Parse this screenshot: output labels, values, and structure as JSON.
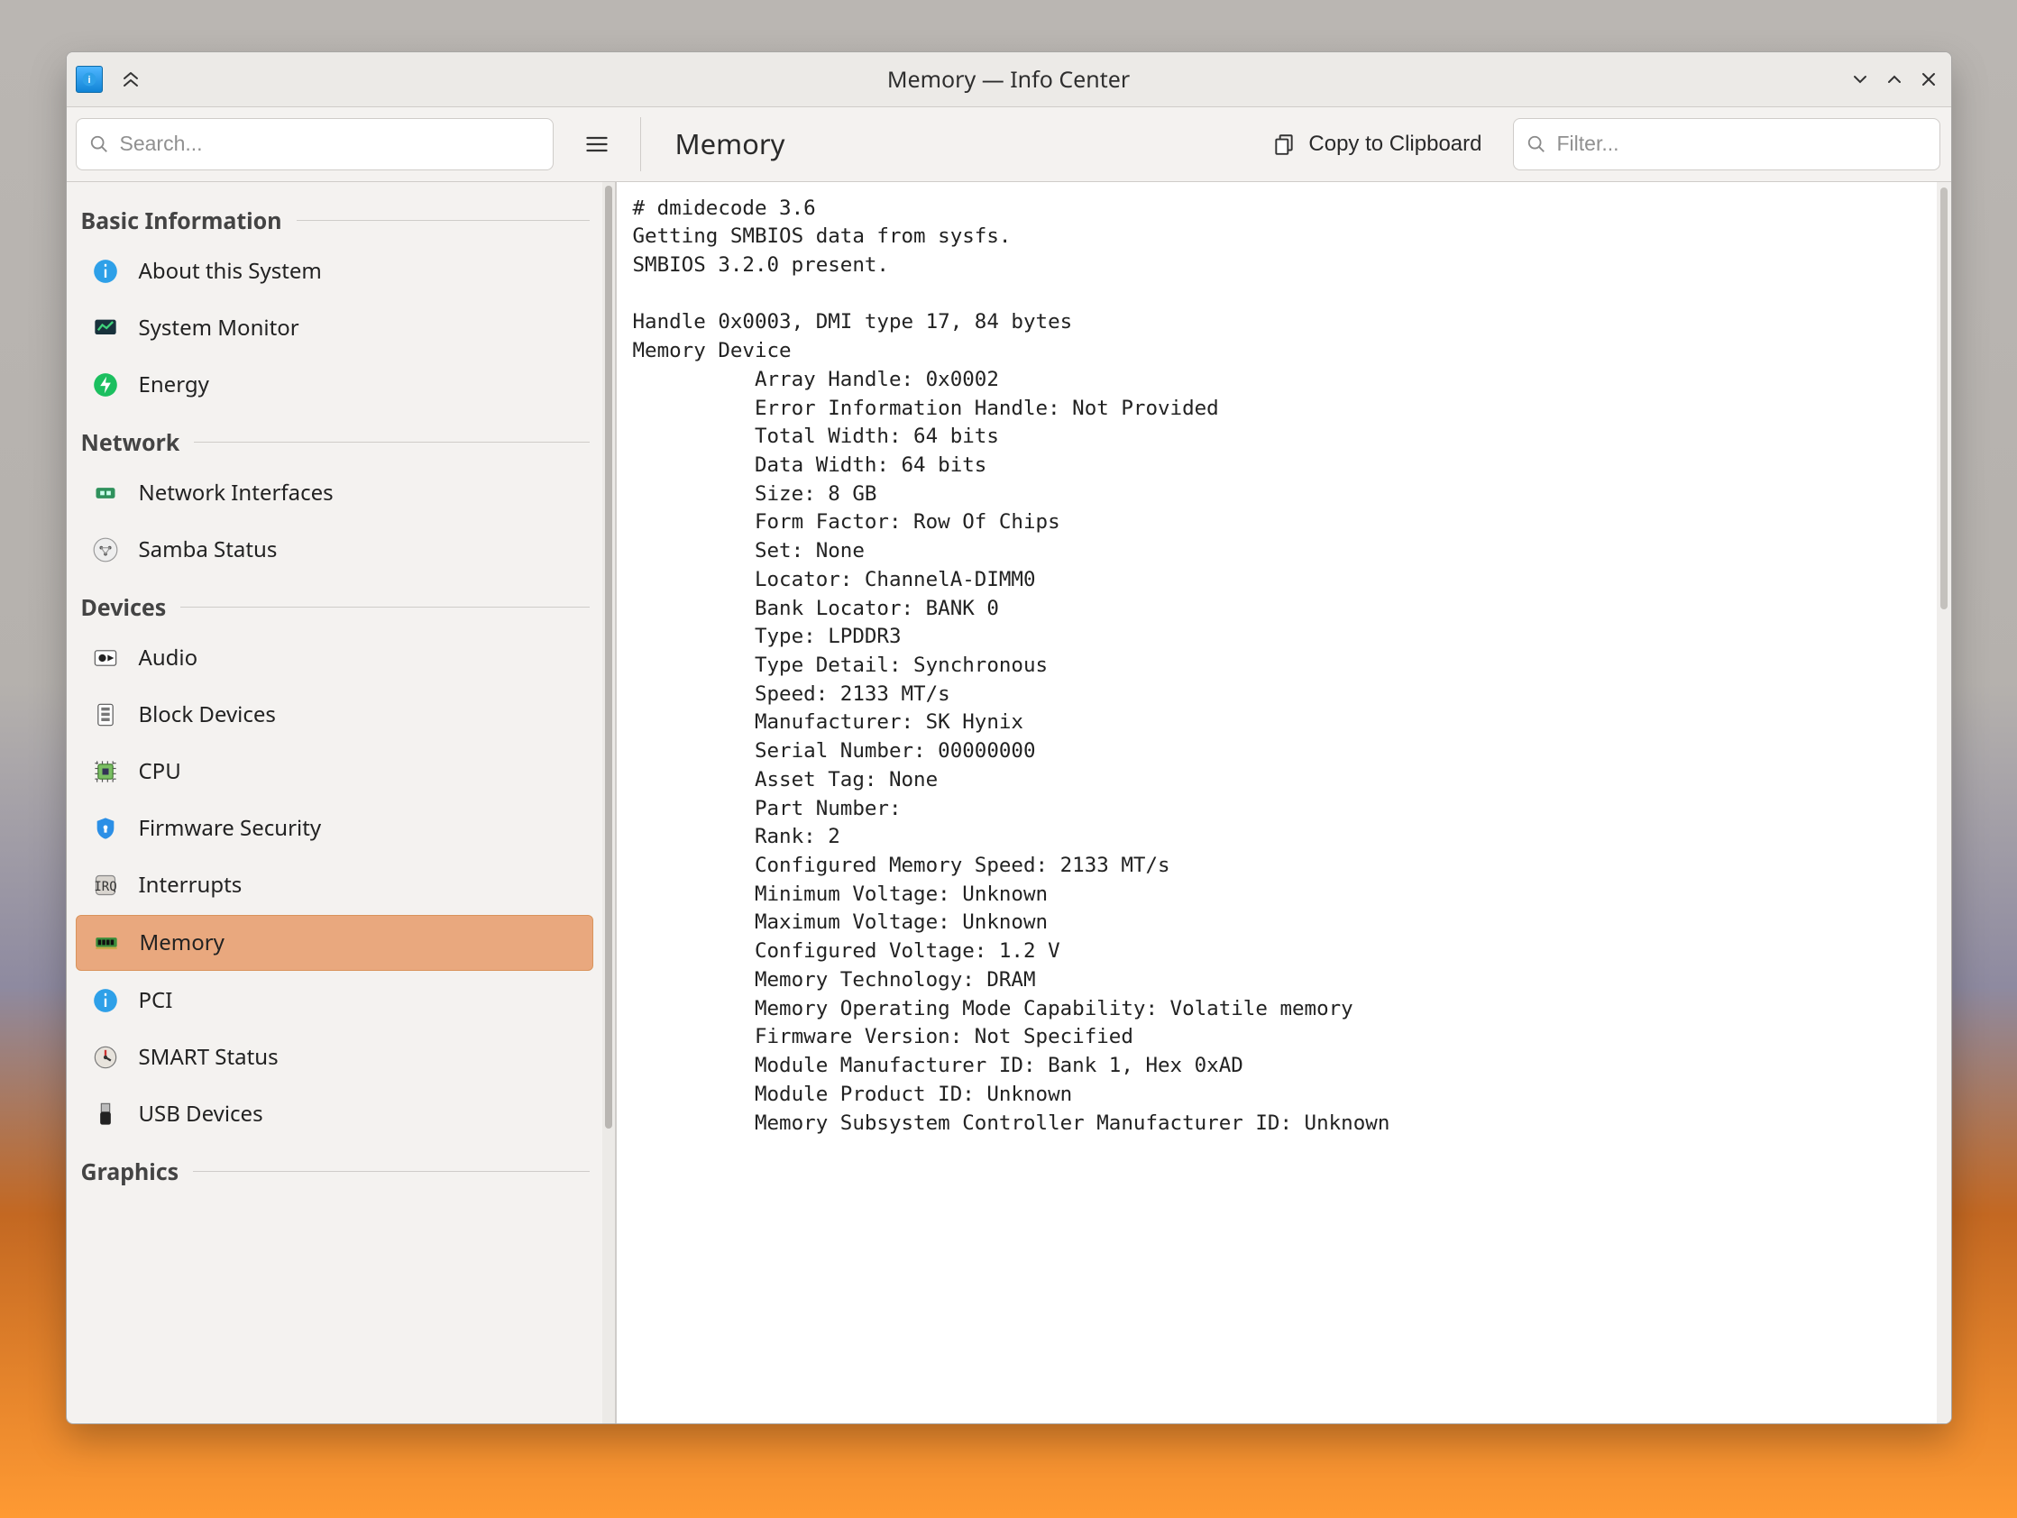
{
  "titlebar": {
    "app_name": "Info Center",
    "window_title": "Memory — Info Center"
  },
  "toolbar": {
    "search_placeholder": "Search...",
    "page_title": "Memory",
    "copy_label": "Copy to Clipboard",
    "filter_placeholder": "Filter..."
  },
  "sidebar": {
    "sections": [
      {
        "title": "Basic Information",
        "items": [
          {
            "id": "about",
            "label": "About this System",
            "icon": "info-icon"
          },
          {
            "id": "sysmon",
            "label": "System Monitor",
            "icon": "monitor-icon"
          },
          {
            "id": "energy",
            "label": "Energy",
            "icon": "energy-icon"
          }
        ]
      },
      {
        "title": "Network",
        "items": [
          {
            "id": "net",
            "label": "Network Interfaces",
            "icon": "nic-icon"
          },
          {
            "id": "samba",
            "label": "Samba Status",
            "icon": "samba-icon"
          }
        ]
      },
      {
        "title": "Devices",
        "items": [
          {
            "id": "audio",
            "label": "Audio",
            "icon": "audio-icon"
          },
          {
            "id": "block",
            "label": "Block Devices",
            "icon": "block-icon"
          },
          {
            "id": "cpu",
            "label": "CPU",
            "icon": "cpu-icon"
          },
          {
            "id": "fwsec",
            "label": "Firmware Security",
            "icon": "shield-icon"
          },
          {
            "id": "irq",
            "label": "Interrupts",
            "icon": "interrupts-icon"
          },
          {
            "id": "memory",
            "label": "Memory",
            "icon": "memory-icon",
            "selected": true
          },
          {
            "id": "pci",
            "label": "PCI",
            "icon": "pci-icon"
          },
          {
            "id": "smart",
            "label": "SMART Status",
            "icon": "smart-icon"
          },
          {
            "id": "usb",
            "label": "USB Devices",
            "icon": "usb-icon"
          }
        ]
      },
      {
        "title": "Graphics",
        "items": []
      }
    ]
  },
  "content": {
    "text": "# dmidecode 3.6\nGetting SMBIOS data from sysfs.\nSMBIOS 3.2.0 present.\n\nHandle 0x0003, DMI type 17, 84 bytes\nMemory Device\n          Array Handle: 0x0002\n          Error Information Handle: Not Provided\n          Total Width: 64 bits\n          Data Width: 64 bits\n          Size: 8 GB\n          Form Factor: Row Of Chips\n          Set: None\n          Locator: ChannelA-DIMM0\n          Bank Locator: BANK 0\n          Type: LPDDR3\n          Type Detail: Synchronous\n          Speed: 2133 MT/s\n          Manufacturer: SK Hynix\n          Serial Number: 00000000\n          Asset Tag: None\n          Part Number: \n          Rank: 2\n          Configured Memory Speed: 2133 MT/s\n          Minimum Voltage: Unknown\n          Maximum Voltage: Unknown\n          Configured Voltage: 1.2 V\n          Memory Technology: DRAM\n          Memory Operating Mode Capability: Volatile memory\n          Firmware Version: Not Specified\n          Module Manufacturer ID: Bank 1, Hex 0xAD\n          Module Product ID: Unknown\n          Memory Subsystem Controller Manufacturer ID: Unknown\n"
  }
}
